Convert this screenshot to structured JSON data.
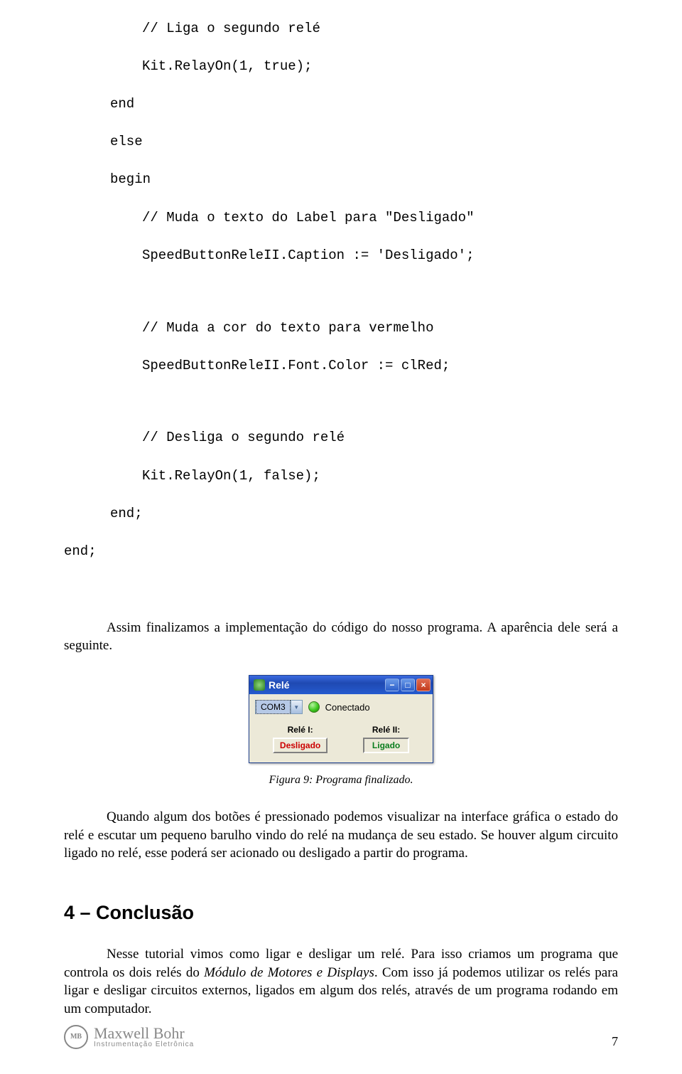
{
  "code": {
    "l1": "// Liga o segundo relé",
    "l2": "Kit.RelayOn(1, true);",
    "l3": "end",
    "l4": "else",
    "l5": "begin",
    "l6": "// Muda o texto do Label para \"Desligado\"",
    "l7": "SpeedButtonReleII.Caption := 'Desligado';",
    "l8": "// Muda a cor do texto para vermelho",
    "l9": "SpeedButtonReleII.Font.Color := clRed;",
    "l10": "// Desliga o segundo relé",
    "l11": "Kit.RelayOn(1, false);",
    "l12": "end;",
    "l13": "end;"
  },
  "para1a": "Assim finalizamos a implementação do código do nosso programa. A aparência dele será a seguinte.",
  "window": {
    "title": "Relé",
    "combo_value": "COM3",
    "conn_status": "Conectado",
    "relay1_label": "Relé I:",
    "relay1_state": "Desligado",
    "relay2_label": "Relé II:",
    "relay2_state": "Ligado"
  },
  "figure_caption": "Figura 9: Programa finalizado.",
  "para2": "Quando algum dos botões é pressionado podemos visualizar na interface gráfica o estado do relé e escutar um pequeno barulho vindo do relé na mudança de seu estado. Se houver algum circuito ligado no relé, esse poderá ser acionado ou desligado a partir do programa.",
  "section_heading": "4 – Conclusão",
  "para3_pre": "Nesse tutorial vimos como ligar e desligar um relé. Para isso criamos um programa que controla os dois relés do ",
  "para3_italic": "Módulo de Motores e Displays",
  "para3_post": ". Com isso já podemos utilizar os relés para ligar e desligar circuitos externos, ligados em algum dos relés, através de um programa rodando em um computador.",
  "brand": {
    "glyph": "MB",
    "name": "Maxwell Bohr",
    "sub": "Instrumentação Eletrônica"
  },
  "page_number": "7"
}
